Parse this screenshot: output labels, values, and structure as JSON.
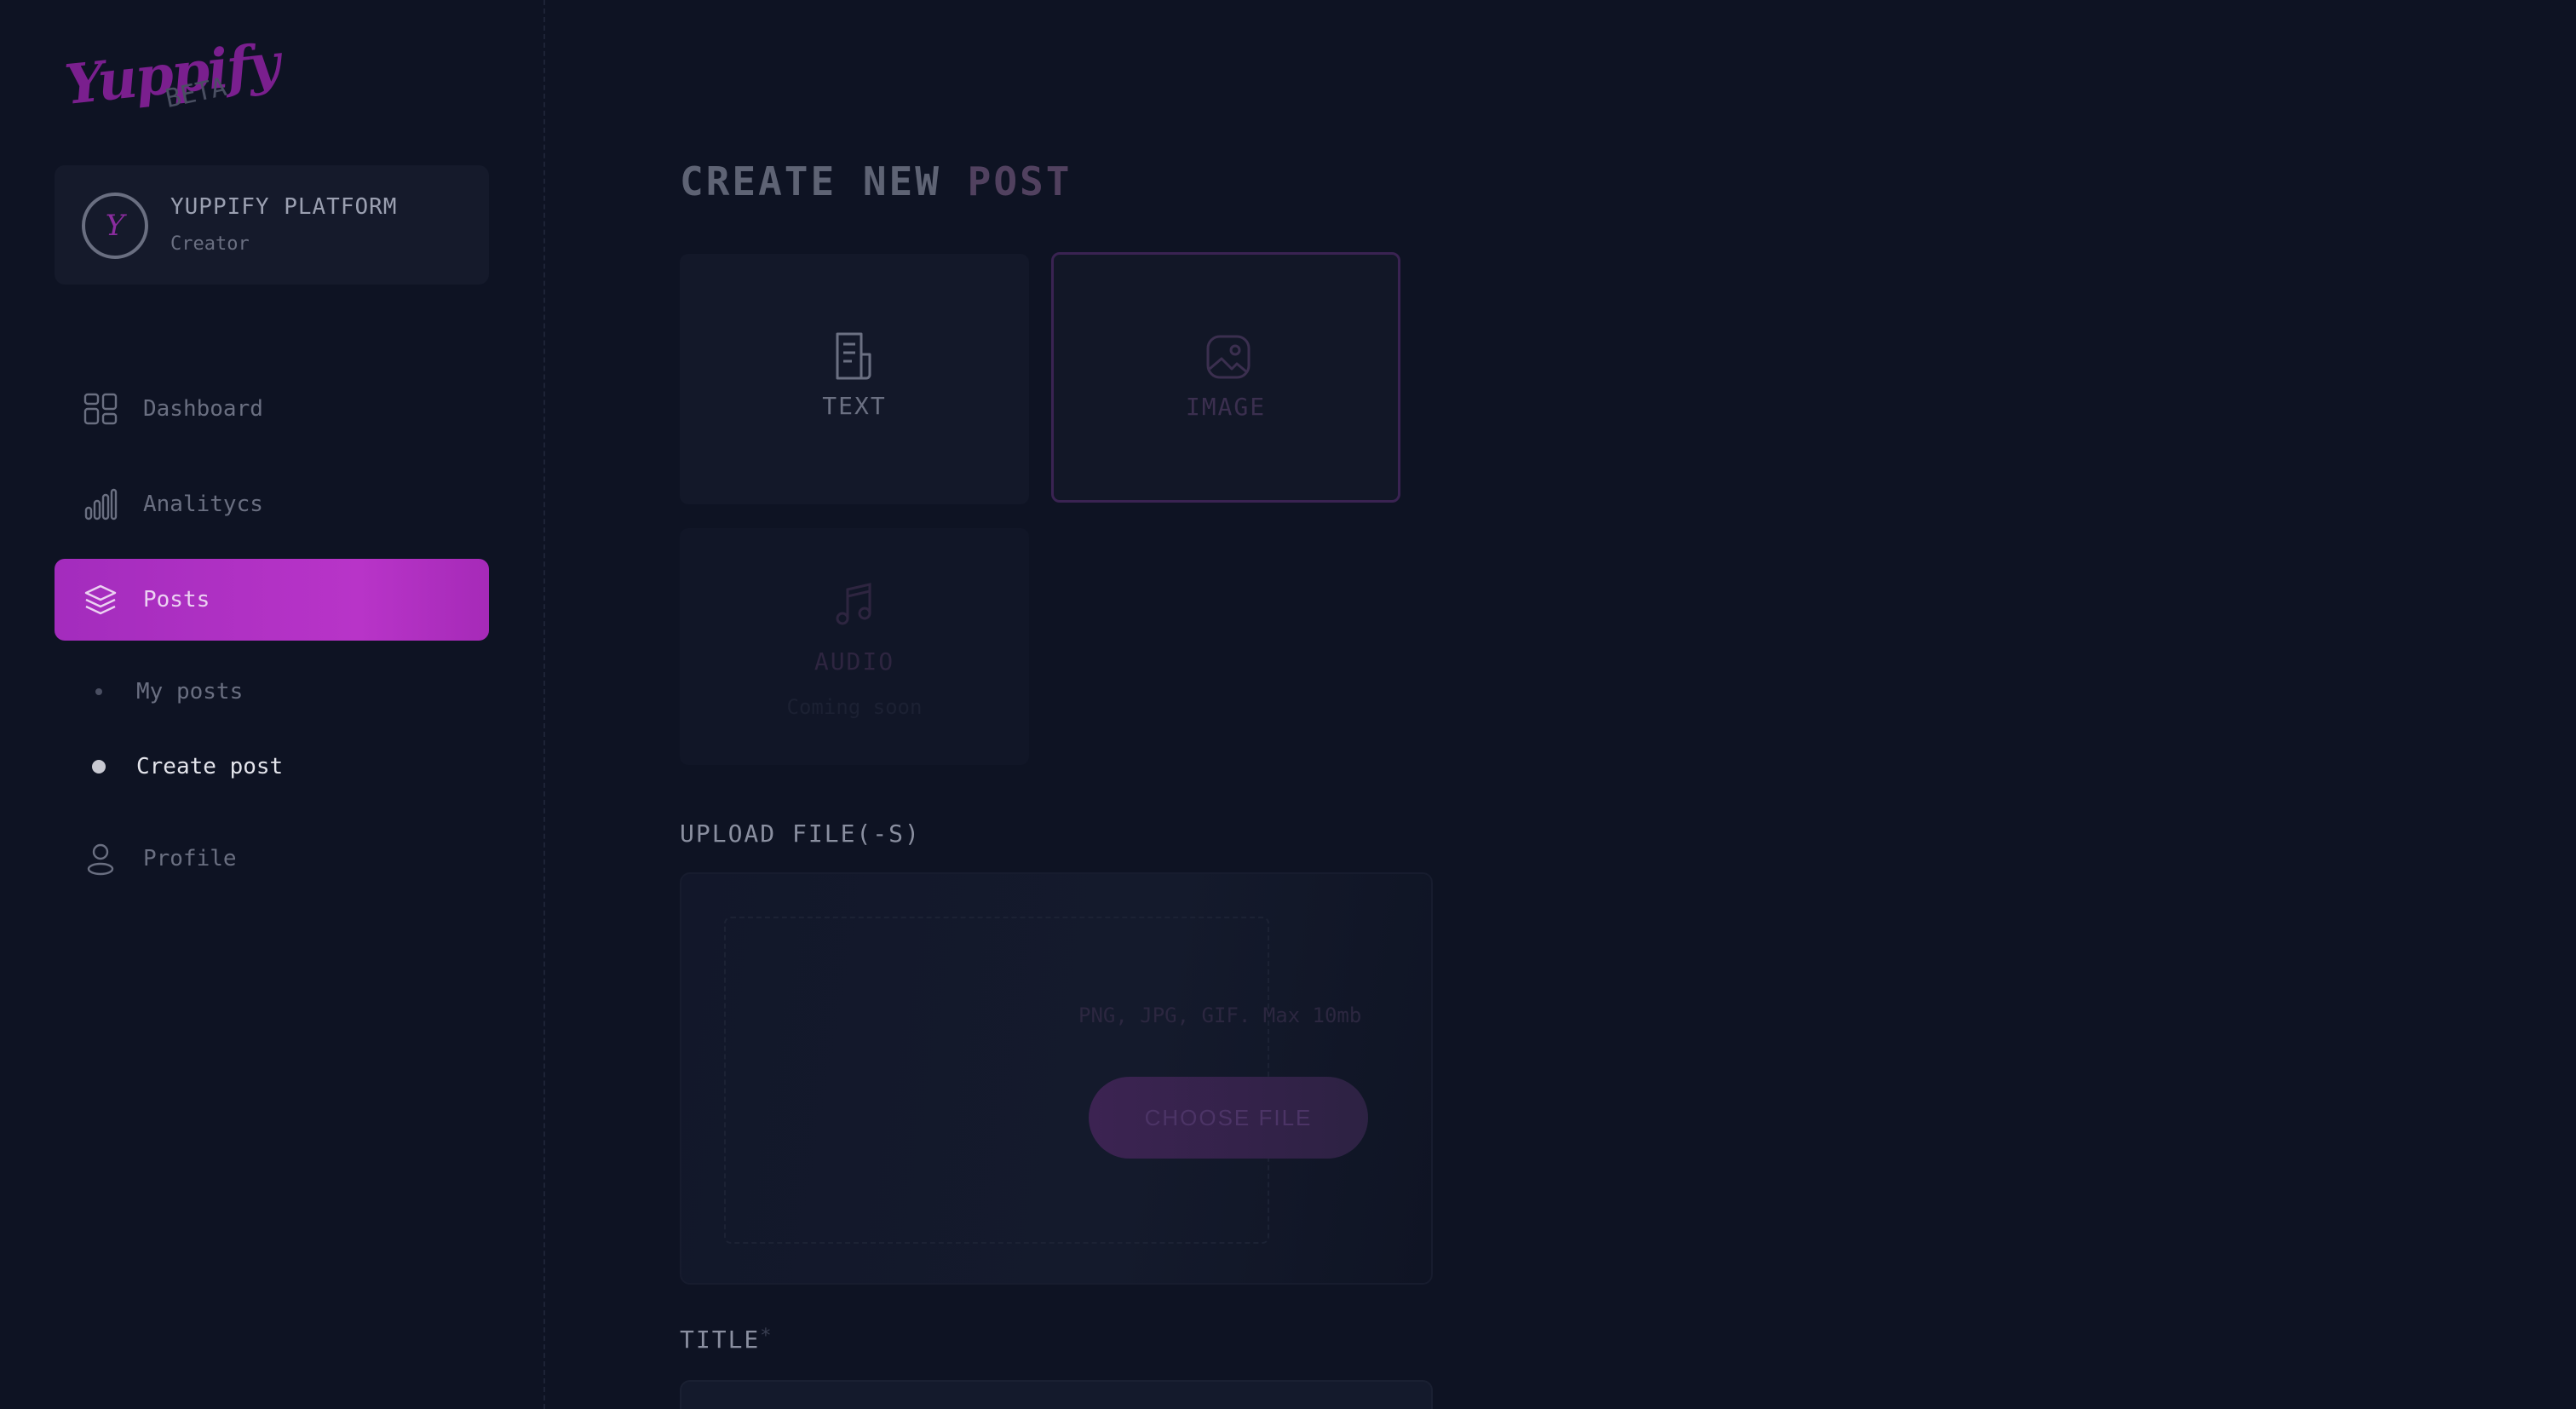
{
  "brand": {
    "logo_text": "Yuppify",
    "beta_label": "BETA",
    "accent_color": "#b834c8"
  },
  "profile": {
    "avatar_letter": "Y",
    "name": "YUPPIFY PLATFORM",
    "role": "Creator"
  },
  "nav": {
    "dashboard": "Dashboard",
    "analytics": "Analitycs",
    "posts": "Posts",
    "my_posts": "My posts",
    "create_post": "Create post",
    "profile": "Profile"
  },
  "main": {
    "title_part1": "CREATE NEW ",
    "title_part2": "POST",
    "types": {
      "text": "TEXT",
      "image": "IMAGE",
      "audio": "AUDIO",
      "audio_sub": "Coming soon"
    },
    "upload_label": "UPLOAD FILE(-S)",
    "upload_hint": "PNG, JPG, GIF. Max 10mb",
    "choose_button": "CHOOSE FILE",
    "title_label": "TITLE",
    "required_mark": "*"
  }
}
